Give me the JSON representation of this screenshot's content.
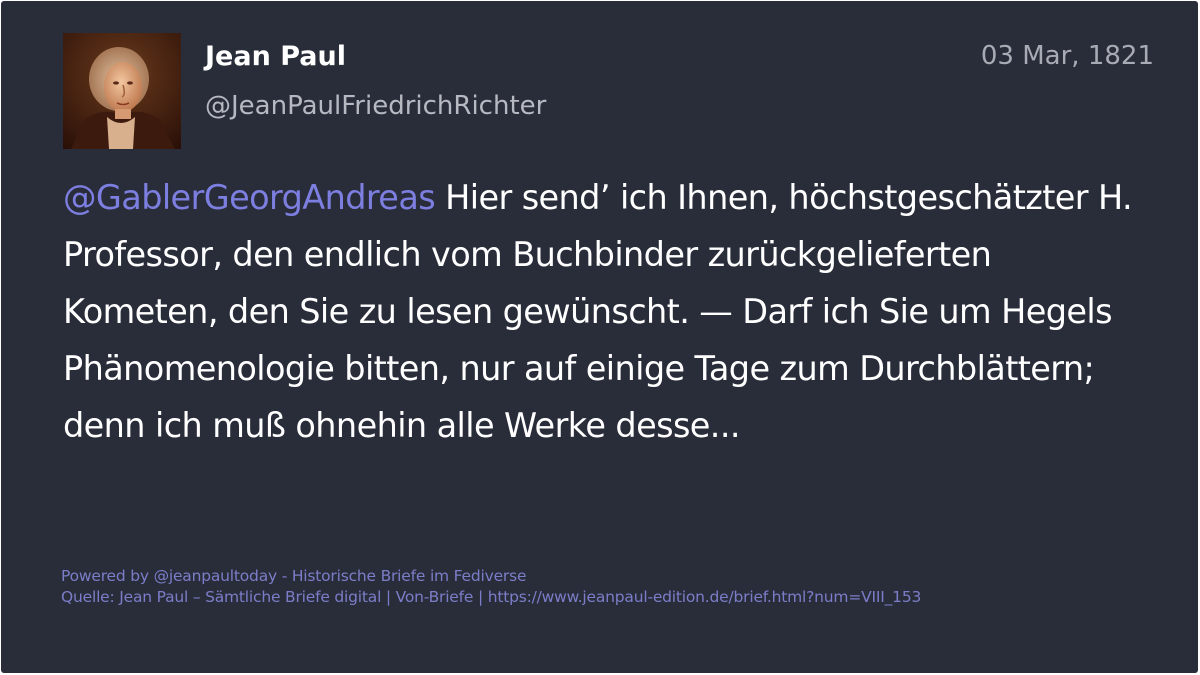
{
  "author": {
    "display_name": "Jean Paul",
    "handle": "@JeanPaulFriedrichRichter",
    "avatar_icon": "portrait-avatar"
  },
  "post": {
    "date": "03 Mar, 1821",
    "mention": "@GablerGeorgAndreas",
    "text": " Hier send’ ich Ihnen, höchstgeschätzter H. Professor, den endlich vom Buchbinder zurückgelieferten Kometen, den Sie zu lesen gewünscht. — Darf ich Sie um Hegels Phänomenologie bitten, nur auf einige Tage zum Durchblättern; denn ich muß ohnehin alle Werke desse..."
  },
  "footer": {
    "powered_by": "Powered by @jeanpaultoday - Historische Briefe im Fediverse",
    "source": "Quelle: Jean Paul – Sämtliche Briefe digital | Von-Briefe | https://www.jeanpaul-edition.de/brief.html?num=VIII_153"
  },
  "colors": {
    "background": "#292d3a",
    "text": "#ffffff",
    "mention": "#7d7fe0",
    "footer": "#7c7dc9",
    "secondary": "#b7b9c2"
  }
}
